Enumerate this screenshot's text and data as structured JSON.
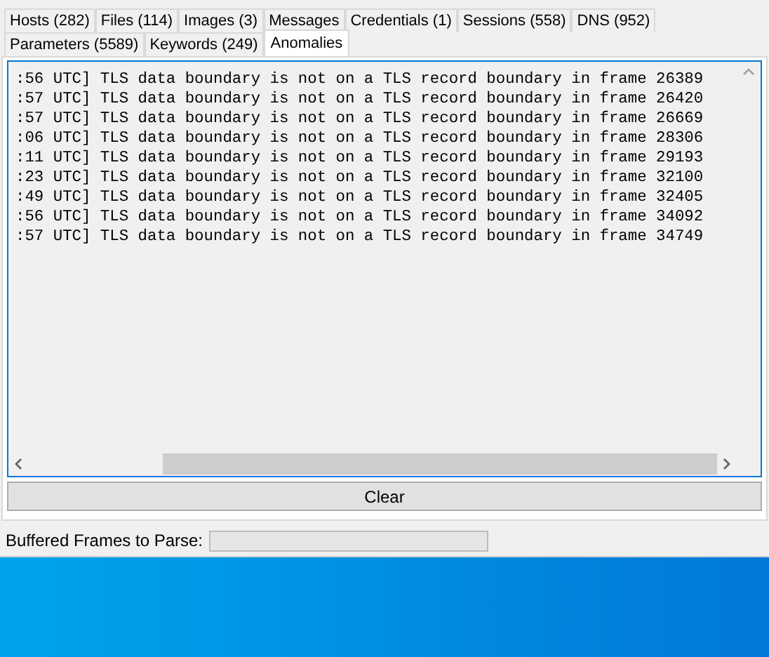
{
  "tab_rows": [
    [
      {
        "label": "Hosts (282)",
        "selected": false
      },
      {
        "label": "Files (114)",
        "selected": false
      },
      {
        "label": "Images (3)",
        "selected": false
      },
      {
        "label": "Messages",
        "selected": false
      },
      {
        "label": "Credentials (1)",
        "selected": false
      },
      {
        "label": "Sessions (558)",
        "selected": false
      },
      {
        "label": "DNS (952)",
        "selected": false
      }
    ],
    [
      {
        "label": "Parameters (5589)",
        "selected": false
      },
      {
        "label": "Keywords (249)",
        "selected": false
      },
      {
        "label": "Anomalies",
        "selected": true
      }
    ]
  ],
  "log_lines": [
    ":56 UTC] TLS data boundary is not on a TLS record boundary in frame 26389",
    ":57 UTC] TLS data boundary is not on a TLS record boundary in frame 26420",
    ":57 UTC] TLS data boundary is not on a TLS record boundary in frame 26669",
    ":06 UTC] TLS data boundary is not on a TLS record boundary in frame 28306",
    ":11 UTC] TLS data boundary is not on a TLS record boundary in frame 29193",
    ":23 UTC] TLS data boundary is not on a TLS record boundary in frame 32100",
    ":49 UTC] TLS data boundary is not on a TLS record boundary in frame 32405",
    ":56 UTC] TLS data boundary is not on a TLS record boundary in frame 34092",
    ":57 UTC] TLS data boundary is not on a TLS record boundary in frame 34749"
  ],
  "clear_button": "Clear",
  "status": {
    "label": "Buffered Frames to Parse:",
    "level": 0
  }
}
